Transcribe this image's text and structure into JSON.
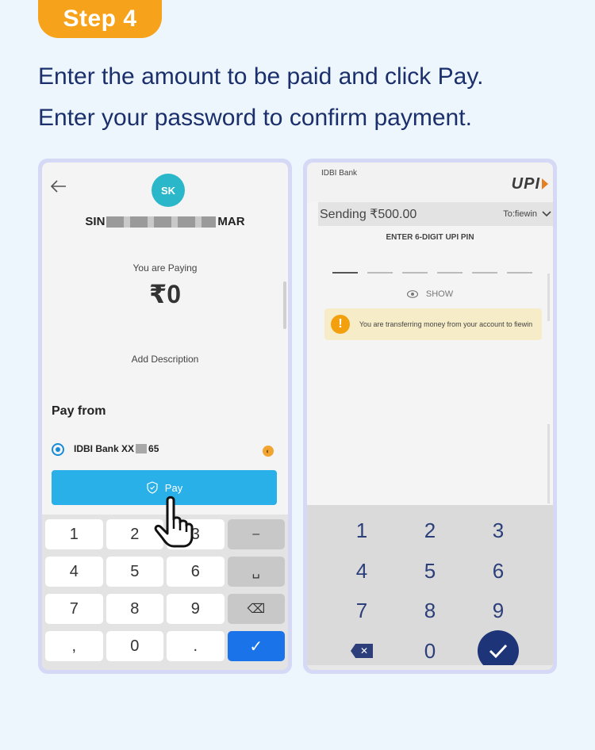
{
  "step": {
    "label": "Step 4"
  },
  "instructions": [
    "Enter the amount to be paid and click Pay.",
    "Enter your password to confirm payment."
  ],
  "left_screen": {
    "avatar_initials": "SK",
    "payee_prefix": "SIN",
    "payee_suffix": "MAR",
    "paying_label": "You are Paying",
    "amount": "₹0",
    "add_description": "Add Description",
    "pay_from_label": "Pay from",
    "bank_prefix": "IDBI Bank XX",
    "bank_suffix": "65",
    "pay_button": "Pay",
    "keypad": [
      "1",
      "2",
      "3",
      "–",
      "4",
      "5",
      "6",
      "␣",
      "7",
      "8",
      "9",
      "⌫",
      ",",
      "0",
      ".",
      "✓"
    ]
  },
  "right_screen": {
    "bank_name": "IDBI Bank",
    "upi_logo": "UPI",
    "sending": "Sending ₹500.00",
    "to": "To:fiewin",
    "pin_title": "ENTER 6-DIGIT UPI PIN",
    "show_label": "SHOW",
    "warning": "You are transferring money from your account to fiewin",
    "keypad": [
      "1",
      "2",
      "3",
      "4",
      "5",
      "6",
      "7",
      "8",
      "9"
    ],
    "zero": "0"
  },
  "colors": {
    "background": "#eef6fd",
    "step_pill": "#f7a21b",
    "instruction_text": "#1a2f6b",
    "pay_button": "#29b0e8",
    "pin_keys": "#2c3f7a"
  }
}
